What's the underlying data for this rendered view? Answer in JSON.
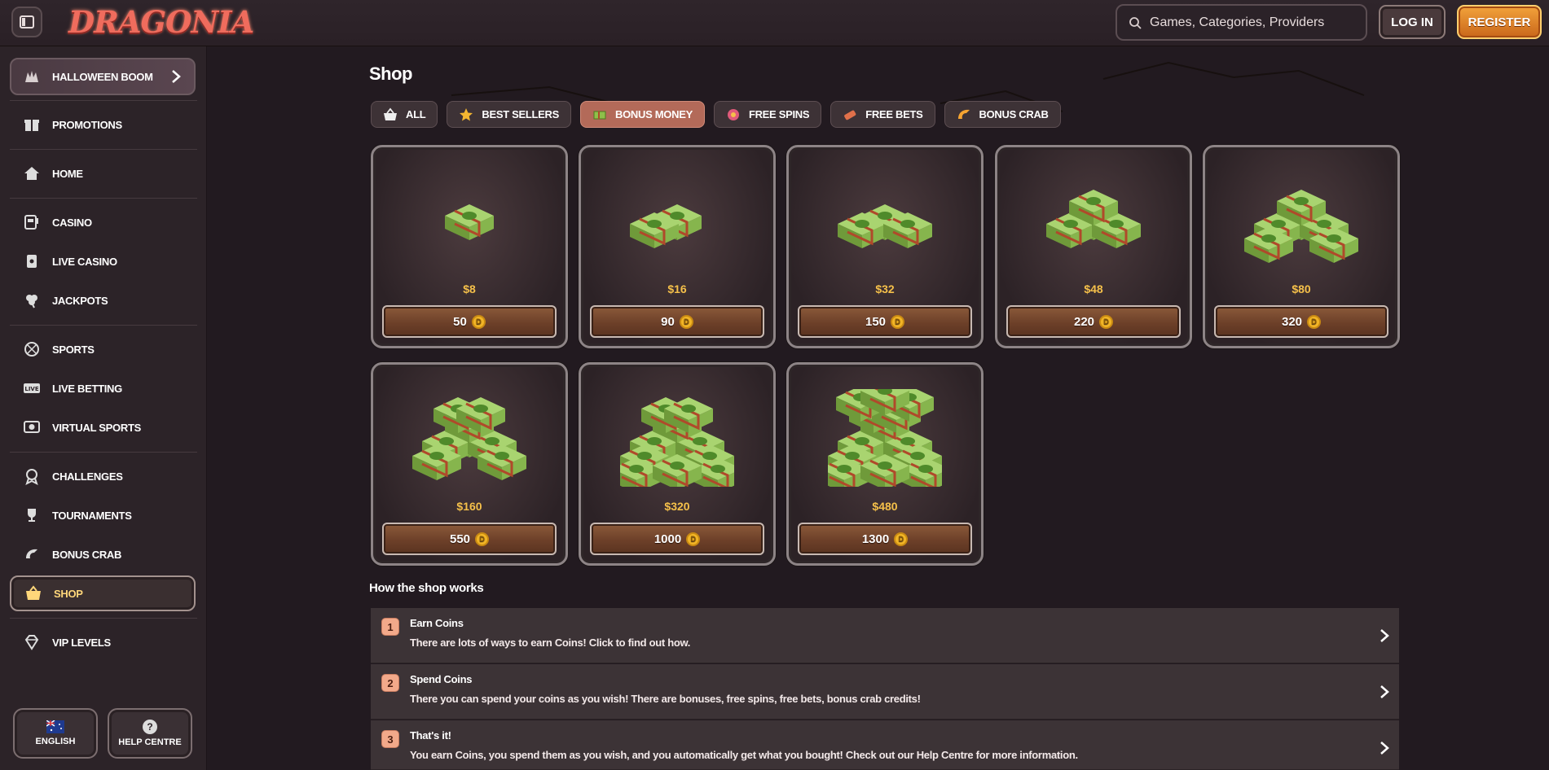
{
  "header": {
    "logo_text": "DRAGONIA",
    "search_placeholder": "Games, Categories, Providers",
    "login_label": "LOG IN",
    "register_label": "REGISTER"
  },
  "sidebar": {
    "promo_banner": {
      "label": "HALLOWEEN BOOM",
      "icon": "halloween-icon"
    },
    "items": [
      {
        "label": "PROMOTIONS",
        "icon": "gift-icon"
      },
      {
        "label": "HOME",
        "icon": "home-icon"
      },
      {
        "label": "CASINO",
        "icon": "slot-machine-icon"
      },
      {
        "label": "LIVE CASINO",
        "icon": "cards-icon"
      },
      {
        "label": "JACKPOTS",
        "icon": "clover-icon"
      },
      {
        "label": "SPORTS",
        "icon": "ball-icon"
      },
      {
        "label": "LIVE BETTING",
        "icon": "live-icon"
      },
      {
        "label": "VIRTUAL SPORTS",
        "icon": "virtual-ball-icon"
      },
      {
        "label": "CHALLENGES",
        "icon": "medal-icon"
      },
      {
        "label": "TOURNAMENTS",
        "icon": "trophy-icon"
      },
      {
        "label": "BONUS CRAB",
        "icon": "crab-claw-icon"
      },
      {
        "label": "SHOP",
        "icon": "basket-icon",
        "active": true
      },
      {
        "label": "VIP LEVELS",
        "icon": "diamond-icon"
      }
    ],
    "language_label": "ENGLISH",
    "help_label": "HELP CENTRE",
    "help_icon_glyph": "?"
  },
  "main": {
    "title": "Shop",
    "filters": [
      {
        "label": "ALL",
        "icon": "basket-icon"
      },
      {
        "label": "BEST SELLERS",
        "icon": "star-icon"
      },
      {
        "label": "BONUS MONEY",
        "icon": "money-icon",
        "active": true
      },
      {
        "label": "FREE SPINS",
        "icon": "spin-icon"
      },
      {
        "label": "FREE BETS",
        "icon": "ticket-icon"
      },
      {
        "label": "BONUS CRAB",
        "icon": "crab-claw-icon"
      }
    ],
    "products": [
      {
        "price": "$8",
        "coins": "50"
      },
      {
        "price": "$16",
        "coins": "90"
      },
      {
        "price": "$32",
        "coins": "150"
      },
      {
        "price": "$48",
        "coins": "220"
      },
      {
        "price": "$80",
        "coins": "320"
      },
      {
        "price": "$160",
        "coins": "550"
      },
      {
        "price": "$320",
        "coins": "1000"
      },
      {
        "price": "$480",
        "coins": "1300"
      }
    ],
    "coin_glyph": "D",
    "how_title": "How the shop works",
    "steps": [
      {
        "num": "1",
        "title": "Earn Coins",
        "desc": "There are lots of ways to earn Coins! Click to find out how."
      },
      {
        "num": "2",
        "title": "Spend Coins",
        "desc": "There you can spend your coins as you wish! There are bonuses, free spins, free bets, bonus crab credits!"
      },
      {
        "num": "3",
        "title": "That's it!",
        "desc": "You earn Coins, you spend them as you wish, and you automatically get what you bought! Check out our Help Centre for more information."
      }
    ]
  },
  "colors": {
    "background": "#221a20",
    "accent_gold": "#f5c04a",
    "active_filter": "#b36a59",
    "register": "#e38a2a"
  }
}
